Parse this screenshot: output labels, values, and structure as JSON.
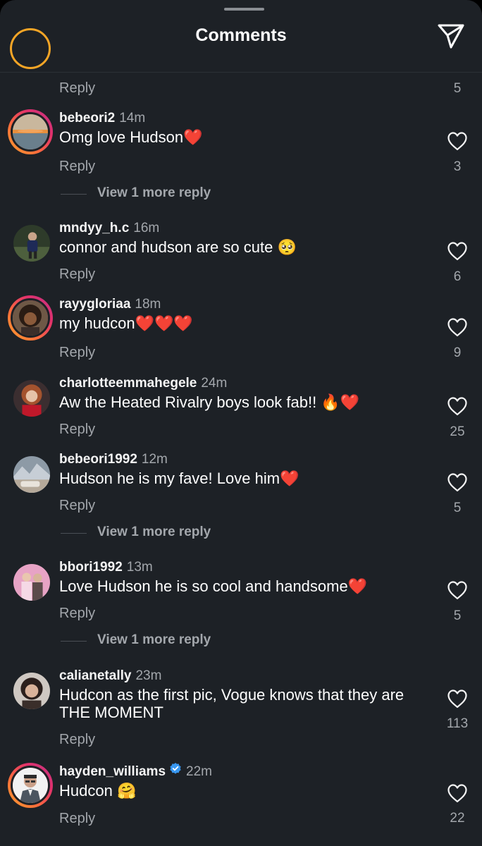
{
  "header": {
    "title": "Comments"
  },
  "top_partial": {
    "reply_label": "Reply",
    "likes": "5"
  },
  "comments": [
    {
      "username": "bebeori2",
      "time": "14m",
      "text": "Omg love Hudson❤️",
      "reply_label": "Reply",
      "likes": "3",
      "view_more": "View 1 more reply"
    },
    {
      "username": "mndyy_h.c",
      "time": "16m",
      "text": "connor and hudson are so cute 🥺",
      "reply_label": "Reply",
      "likes": "6"
    },
    {
      "username": "rayygloriaa",
      "time": "18m",
      "text": "my hudcon❤️❤️❤️",
      "reply_label": "Reply",
      "likes": "9"
    },
    {
      "username": "charlotteemmahegele",
      "time": "24m",
      "text": "Aw the Heated Rivalry boys look fab!! 🔥❤️",
      "reply_label": "Reply",
      "likes": "25"
    },
    {
      "username": "bebeori1992",
      "time": "12m",
      "text": "Hudson he is my fave! Love him❤️",
      "reply_label": "Reply",
      "likes": "5",
      "view_more": "View 1 more reply"
    },
    {
      "username": "bbori1992",
      "time": "13m",
      "text": "Love Hudson he is so cool and handsome❤️",
      "reply_label": "Reply",
      "likes": "5",
      "view_more": "View 1 more reply"
    },
    {
      "username": "calianetally",
      "time": "23m",
      "text": "Hudcon as the first pic, Vogue knows that they are THE MOMENT",
      "reply_label": "Reply",
      "likes": "113"
    },
    {
      "username": "hayden_williams",
      "time": "22m",
      "text": "Hudcon 🤗",
      "reply_label": "Reply",
      "likes": "22",
      "verified": true
    }
  ],
  "icons": {
    "share": "paper-plane-icon",
    "like": "heart-outline-icon",
    "verified": "verified-badge-icon"
  },
  "colors": {
    "background": "#1d2126",
    "secondary_text": "#a3a7ac",
    "verified": "#3897f0"
  }
}
